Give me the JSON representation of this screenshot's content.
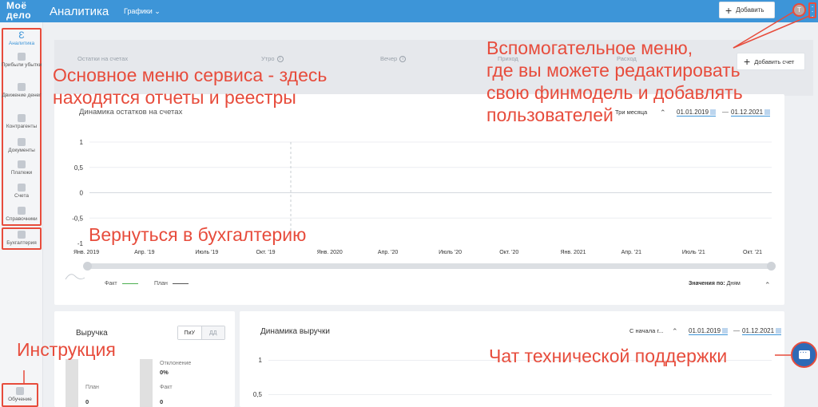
{
  "topbar": {
    "logo_line1": "Моё",
    "logo_line2": "дело",
    "title": "Аналитика",
    "section": "Графики",
    "add_button": "Добавить",
    "avatar_letter": "Т",
    "colors": {
      "header": "#3d95d8",
      "annotation": "#e74c3c"
    }
  },
  "sidebar": {
    "items": [
      {
        "label": "Аналитика",
        "icon": "analytics-icon",
        "active": true
      },
      {
        "label": "Прибыли убытки",
        "icon": "chart-icon"
      },
      {
        "label": "Движение денег",
        "icon": "money-flow-icon"
      },
      {
        "label": "Контрагенты",
        "icon": "people-icon"
      },
      {
        "label": "Документы",
        "icon": "document-icon"
      },
      {
        "label": "Платежи",
        "icon": "payment-icon"
      },
      {
        "label": "Счета",
        "icon": "invoice-icon"
      },
      {
        "label": "Справочники",
        "icon": "folder-icon"
      }
    ],
    "accounting": "Бухгалтерия",
    "learning": "Обучение"
  },
  "accounts_bar": {
    "balance": "Остатки на счетах",
    "morning": "Утро",
    "evening": "Вечер",
    "income": "Приход",
    "expense": "Расход",
    "add_account": "Добавить счет"
  },
  "balance_chart": {
    "period": "Три месяца",
    "date_from": "01.01.2019",
    "date_to": "01.12.2021",
    "legend_fact": "Факт",
    "legend_plan": "План",
    "values_by_label": "Значения по:",
    "values_by_value": "Дням"
  },
  "revenue": {
    "title": "Выручка",
    "toggle_a": "ПиУ",
    "toggle_b": "ДД",
    "deviation_label": "Отклонение",
    "deviation_value": "0%",
    "plan_label": "План",
    "plan_value": "0",
    "fact_label": "Факт",
    "fact_value": "0"
  },
  "revenue_dynamics": {
    "title": "Динамика выручки",
    "period": "С начала г...",
    "date_from": "01.01.2019",
    "date_to": "01.12.2021",
    "y_ticks": [
      "1",
      "0,5"
    ]
  },
  "annotations": {
    "main_menu": [
      "Основное меню сервиса - здесь",
      "находятся отчеты и реестры"
    ],
    "aux_menu": [
      "Вспомогательное меню,",
      "где вы можете редактировать",
      "свою финмодель и добавлять",
      "пользователей"
    ],
    "back_to_accounting": "Вернуться в бухгалтерию",
    "instructions": "Инструкция",
    "support_chat": "Чат технической поддержки"
  },
  "chart_data": {
    "type": "line",
    "title": "Динамика остатков на счетах",
    "ylim": [
      -1,
      1
    ],
    "y_ticks": [
      "1",
      "0,5",
      "0",
      "-0,5",
      "-1"
    ],
    "x_ticks": [
      "Янв. 2019",
      "Апр. '19",
      "Июль '19",
      "Окт. '19",
      "Янв. 2020",
      "Апр. '20",
      "Июль '20",
      "Окт. '20",
      "Янв. 2021",
      "Апр. '21",
      "Июль '21",
      "Окт. '21"
    ],
    "series": [
      {
        "name": "Факт",
        "color": "#4caf50",
        "values": []
      },
      {
        "name": "План",
        "color": "#9e9e9e",
        "values": []
      }
    ],
    "grid": true
  }
}
